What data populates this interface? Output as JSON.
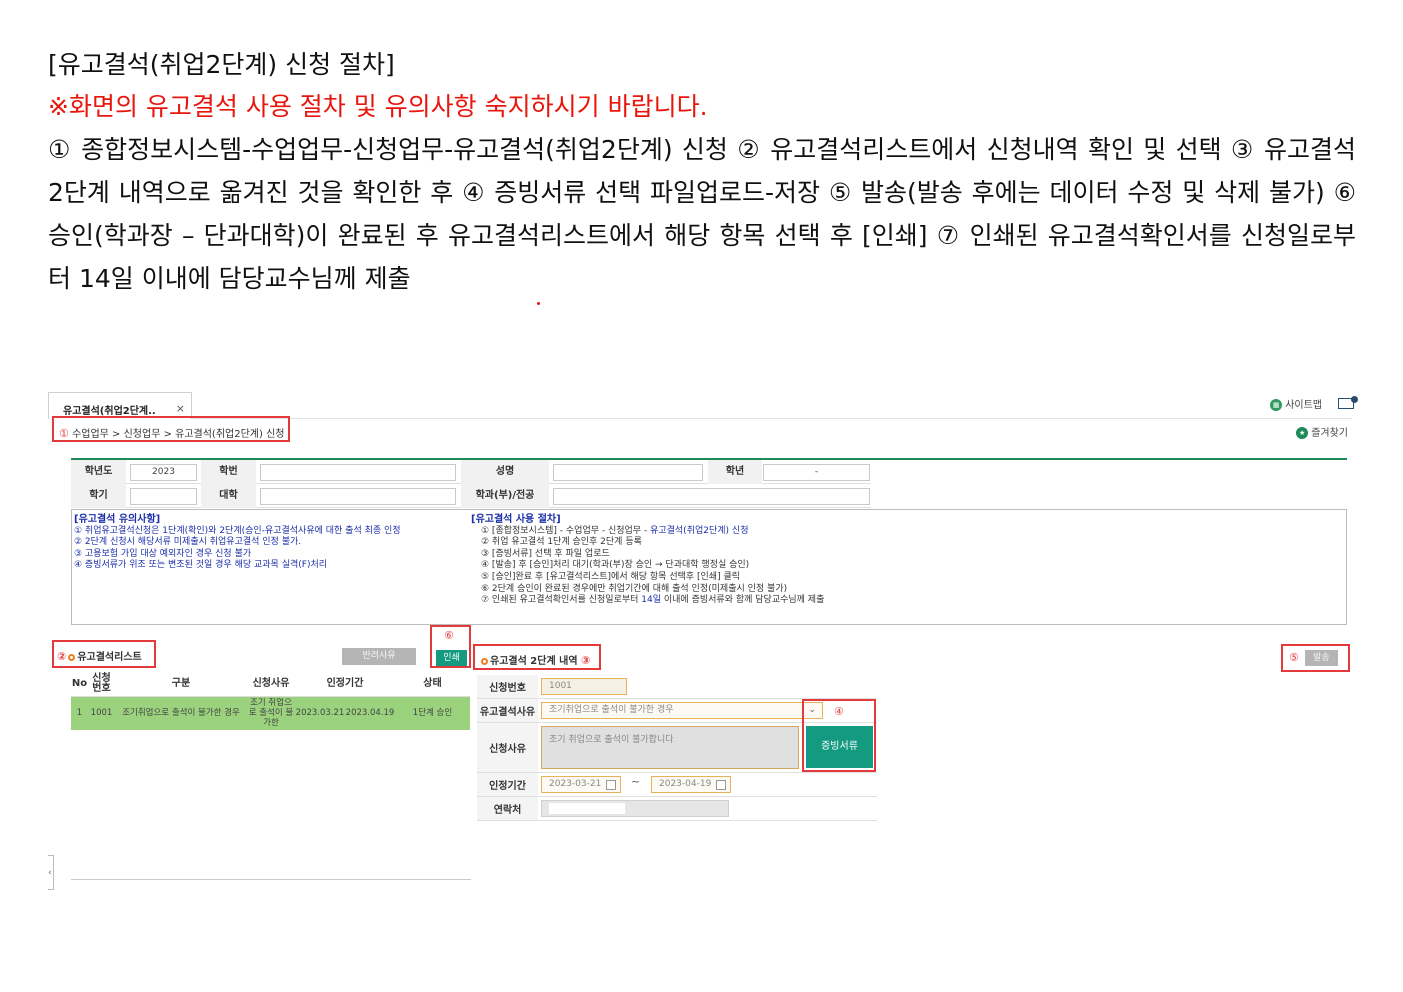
{
  "intro": {
    "heading": "[유고결석(취업2단계) 신청 절차]",
    "notice": "※화면의 유고결석 사용 절차 및 유의사항 숙지하시기 바랍니다.",
    "steps": "① 종합정보시스템-수업업무-신청업무-유고결석(취업2단계) 신청 ② 유고결석리스트에서 신청내역 확인 및 선택 ③ 유고결석 2단계 내역으로 옮겨진 것을 확인한 후 ④ 증빙서류 선택 파일업로드-저장 ⑤ 발송(발송 후에는 데이터 수정 및 삭제 불가) ⑥ 승인(학과장 – 단과대학)이 완료된 후 유고결석리스트에서 해당 항목 선택 후 [인쇄] ⑦ 인쇄된 유고결석확인서를 신청일로부터 14일 이내에 담당교수님께 제출"
  },
  "app": {
    "tab_title": "유고결석(취업2단계..",
    "tab_close": "×",
    "sitemap": "사이트맵",
    "favorites": "즐겨찾기",
    "breadcrumb": {
      "num": "①",
      "text": "수업업무 > 신청업무 > 유고결석(취업2단계) 신청"
    },
    "form": {
      "year_label": "학년도",
      "year_value": "2023",
      "student_no_label": "학번",
      "name_label": "성명",
      "grade_label": "학년",
      "grade_value": "-",
      "semester_label": "학기",
      "college_label": "대학",
      "dept_label": "학과(부)/전공"
    },
    "cautions": {
      "title": "[유고결석 유의사항]",
      "items": [
        "① 취업유고결석신청은 1단계(확인)와 2단계(승인-유고결석사유에 대한 출석 최종 인정",
        "② 2단계 신청시 해당서류 미제출시 취업유고결석 인정 불가.",
        "③ 고용보험 가입 대상 예외자인 경우 신청 불가",
        "④ 증빙서류가 위조 또는 변조된 것일 경우 해당 교과목 실격(F)처리"
      ]
    },
    "procedure": {
      "title": "[유고결석 사용 절차]",
      "items": [
        "① [종합정보시스템] - 수업업무 - 신청업무 - ",
        "② 취업 유고결석 1단계 승인후 2단계 등록",
        "③ [증빙서류] 선택 후 파일 업로드",
        "④ [발송] 후 [승인]처리 대기(학과(부)장 승인 → 단과대학 행정실 승인)",
        "⑤ [승인]완료 후 [유고결석리스트]에서 해당 항목 선택후 [인쇄] 클릭",
        "⑥ 2단계 승인이 완료된 경우에만 취업기간에 대해 출석 인정(미제출시 인정 불가)",
        "⑦ 인쇄된 유고결석확인서를 신청일로부터 ",
        "14일",
        " 이내에 증빙서류와 함께 담당교수님께 제출",
        "유고결석(취업2단계) 신청"
      ]
    },
    "list": {
      "num": "②",
      "title": "유고결석리스트",
      "reject_button": "반려사유",
      "print_num": "⑥",
      "print_button": "인쇄",
      "columns": [
        "No",
        "신청\n번호",
        "구분",
        "신청사유",
        "인정기간",
        "",
        "상태"
      ],
      "rows": [
        {
          "no": "1",
          "req_no": "1001",
          "category": "조기취업으로 출석이 불가한 경우",
          "reason": "조기 취업으로 출석이 불가한",
          "start": "2023.03.21",
          "end": "2023.04.19",
          "status": "1단계 승인"
        }
      ],
      "scroll_left": "‹"
    },
    "detail": {
      "title": "유고결석 2단계 내역",
      "num": "③",
      "send_num": "⑤",
      "send_button": "발송",
      "req_no_label": "신청번호",
      "req_no_value": "1001",
      "reason_type_label": "유고결석사유",
      "reason_type_value": "조기취업으로 출석이 불가한 경우",
      "evidence_num": "④",
      "reason_label": "신청사유",
      "reason_value": "조기 취업으로 출석이 불가합니다",
      "evidence_button": "증빙서류",
      "period_label": "인정기간",
      "period_start": "2023-03-21",
      "period_sep": "~",
      "period_end": "2023-04-19",
      "contact_label": "연락처"
    }
  }
}
